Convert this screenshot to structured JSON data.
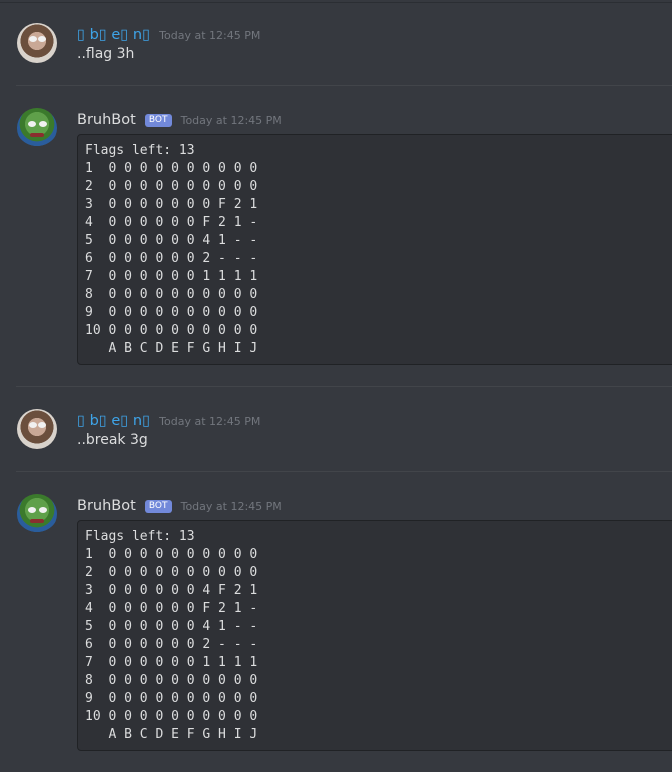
{
  "messages": [
    {
      "username": "▯ b▯ e▯ n▯",
      "timestamp": "Today at 12:45 PM",
      "text": "..flag 3h"
    },
    {
      "username": "BruhBot",
      "bot_tag": "BOT",
      "timestamp": "Today at 12:45 PM",
      "code": "Flags left: 13\n1  0 0 0 0 0 0 0 0 0 0\n2  0 0 0 0 0 0 0 0 0 0\n3  0 0 0 0 0 0 0 F 2 1\n4  0 0 0 0 0 0 F 2 1 -\n5  0 0 0 0 0 0 4 1 - -\n6  0 0 0 0 0 0 2 - - -\n7  0 0 0 0 0 0 1 1 1 1\n8  0 0 0 0 0 0 0 0 0 0\n9  0 0 0 0 0 0 0 0 0 0\n10 0 0 0 0 0 0 0 0 0 0\n   A B C D E F G H I J"
    },
    {
      "username": "▯ b▯ e▯ n▯",
      "timestamp": "Today at 12:45 PM",
      "text": "..break 3g"
    },
    {
      "username": "BruhBot",
      "bot_tag": "BOT",
      "timestamp": "Today at 12:45 PM",
      "code": "Flags left: 13\n1  0 0 0 0 0 0 0 0 0 0\n2  0 0 0 0 0 0 0 0 0 0\n3  0 0 0 0 0 0 4 F 2 1\n4  0 0 0 0 0 0 F 2 1 -\n5  0 0 0 0 0 0 4 1 - -\n6  0 0 0 0 0 0 2 - - -\n7  0 0 0 0 0 0 1 1 1 1\n8  0 0 0 0 0 0 0 0 0 0\n9  0 0 0 0 0 0 0 0 0 0\n10 0 0 0 0 0 0 0 0 0 0\n   A B C D E F G H I J"
    }
  ]
}
